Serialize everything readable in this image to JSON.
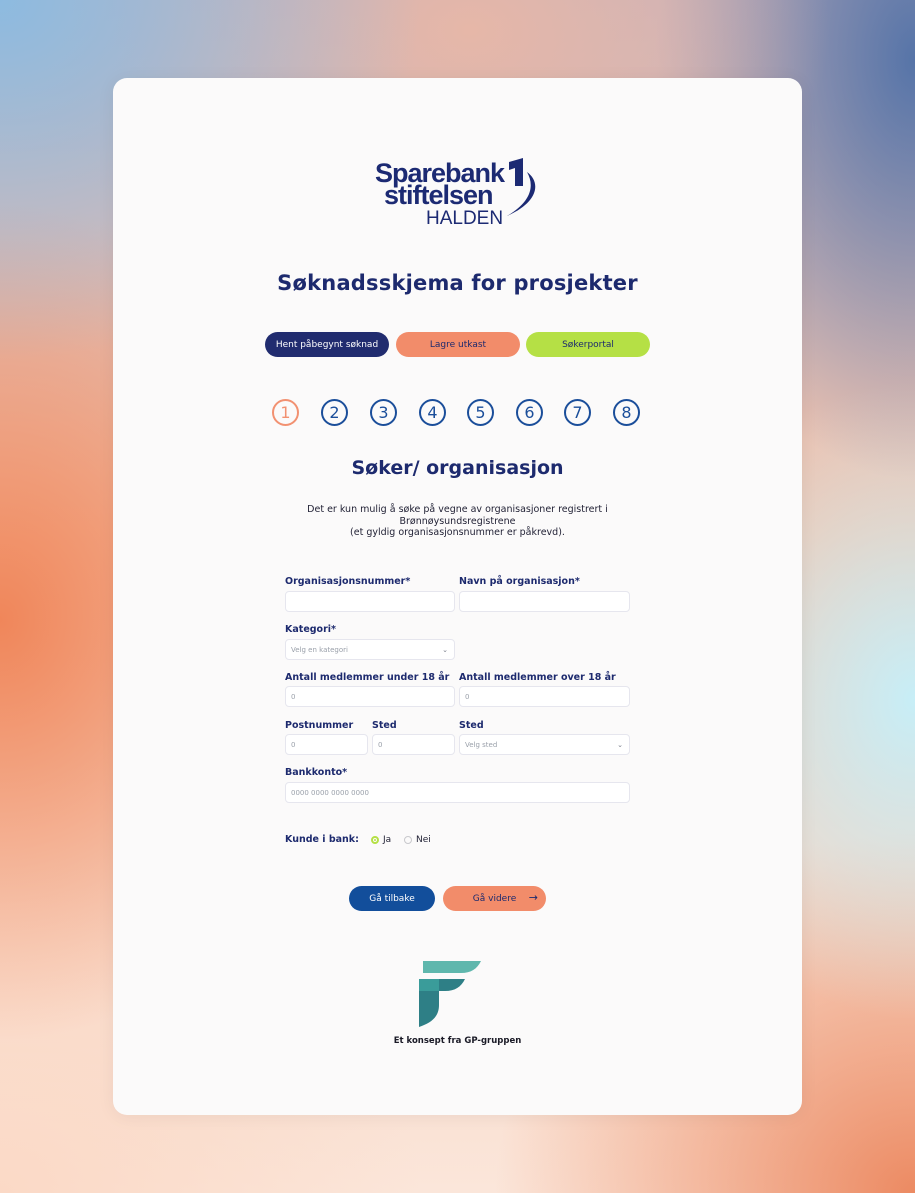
{
  "logo": {
    "line1": "Sparebank",
    "line2": "stiftelsen",
    "line3": "HALDEN",
    "mark_icon": "sparebank1-logo-icon"
  },
  "title": "Søknadsskjema for prosjekter",
  "actions": {
    "load_label": "Hent påbegynt søknad",
    "draft_label": "Lagre utkast",
    "portal_label": "Søkerportal"
  },
  "steps": [
    "1",
    "2",
    "3",
    "4",
    "5",
    "6",
    "7",
    "8"
  ],
  "active_step": 1,
  "section": {
    "title": "Søker/ organisasjon",
    "intro_line1": "Det er kun mulig å søke på vegne av organisasjoner registrert i",
    "intro_line2": "Brønnøysundsregistrene",
    "intro_line3": "(et gyldig organisasjonsnummer er påkrevd)."
  },
  "form": {
    "org_number_label": "Organisasjonsnummer*",
    "org_number_value": "",
    "org_name_label": "Navn på organisasjon*",
    "org_name_value": "",
    "category_label": "Kategori*",
    "category_placeholder": "Velg en kategori",
    "members_under_label": "Antall medlemmer under 18 år",
    "members_under_value": "0",
    "members_over_label": "Antall medlemmer over 18 år",
    "members_over_value": "0",
    "postal_label": "Postnummer",
    "postal_value": "0",
    "place_label": "Sted",
    "place_value": "0",
    "place_select_label": "Sted",
    "place_select_placeholder": "Velg sted",
    "bank_label": "Bankkonto*",
    "bank_placeholder": "0000 0000 0000 0000",
    "customer_label": "Kunde i bank:",
    "customer_yes": "Ja",
    "customer_no": "Nei",
    "customer_selected": "Ja"
  },
  "nav": {
    "back_label": "Gå tilbake",
    "next_label": "Gå videre",
    "next_icon": "arrow-right-icon"
  },
  "footer": {
    "logo_icon": "gp-gruppen-logo-icon",
    "text": "Et konsept fra GP-gruppen"
  },
  "colors": {
    "navy": "#1d2a6e",
    "blue": "#124e9b",
    "orange": "#f28c6a",
    "lime": "#b5e045",
    "teal": "#3a9c9a"
  }
}
